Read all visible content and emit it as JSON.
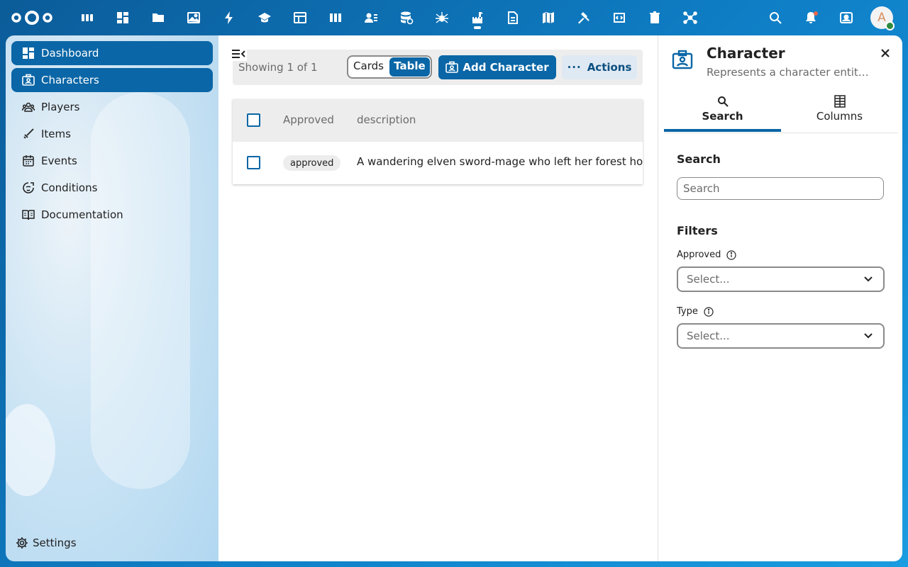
{
  "topbar": {
    "apps": [
      {
        "name": "dashboard-app-icon"
      },
      {
        "name": "grid-app-icon"
      },
      {
        "name": "files-app-icon"
      },
      {
        "name": "photos-app-icon"
      },
      {
        "name": "activity-app-icon"
      },
      {
        "name": "learning-app-icon"
      },
      {
        "name": "tables-app-icon"
      },
      {
        "name": "deck-app-icon"
      },
      {
        "name": "contacts-app-icon"
      },
      {
        "name": "database-app-icon"
      },
      {
        "name": "spider-app-icon"
      },
      {
        "name": "castle-app-icon"
      },
      {
        "name": "notes-app-icon"
      },
      {
        "name": "map-app-icon"
      },
      {
        "name": "hammer-app-icon"
      },
      {
        "name": "code-app-icon"
      },
      {
        "name": "trash-app-icon"
      },
      {
        "name": "network-app-icon"
      }
    ],
    "avatar_initial": "A"
  },
  "sidebar": {
    "items": [
      {
        "label": "Dashboard",
        "icon": "dashboard-icon",
        "active": true
      },
      {
        "label": "Characters",
        "icon": "contact-card-icon",
        "active": true
      },
      {
        "label": "Players",
        "icon": "people-icon",
        "active": false
      },
      {
        "label": "Items",
        "icon": "sword-icon",
        "active": false
      },
      {
        "label": "Events",
        "icon": "calendar-icon",
        "active": false
      },
      {
        "label": "Conditions",
        "icon": "condition-icon",
        "active": false
      },
      {
        "label": "Documentation",
        "icon": "book-icon",
        "active": false
      }
    ],
    "settings_label": "Settings"
  },
  "main": {
    "showing": "Showing 1 of 1",
    "view_options": [
      "Cards",
      "Table"
    ],
    "selected_view": "Table",
    "add_label": "Add Character",
    "actions_label": "Actions",
    "table": {
      "columns": [
        "Approved",
        "description"
      ],
      "rows": [
        {
          "approved": "approved",
          "description": "A wandering elven sword-mage who left her forest ho"
        }
      ]
    }
  },
  "panel": {
    "title": "Character",
    "subtitle": "Represents a character entit…",
    "tabs": [
      "Search",
      "Columns"
    ],
    "active_tab": "Search",
    "search_heading": "Search",
    "search_placeholder": "Search",
    "filters_heading": "Filters",
    "filters": [
      {
        "label": "Approved",
        "placeholder": "Select..."
      },
      {
        "label": "Type",
        "placeholder": "Select..."
      }
    ]
  },
  "colors": {
    "primary": "#0a66a6",
    "header_bg": "#0b5c99"
  }
}
